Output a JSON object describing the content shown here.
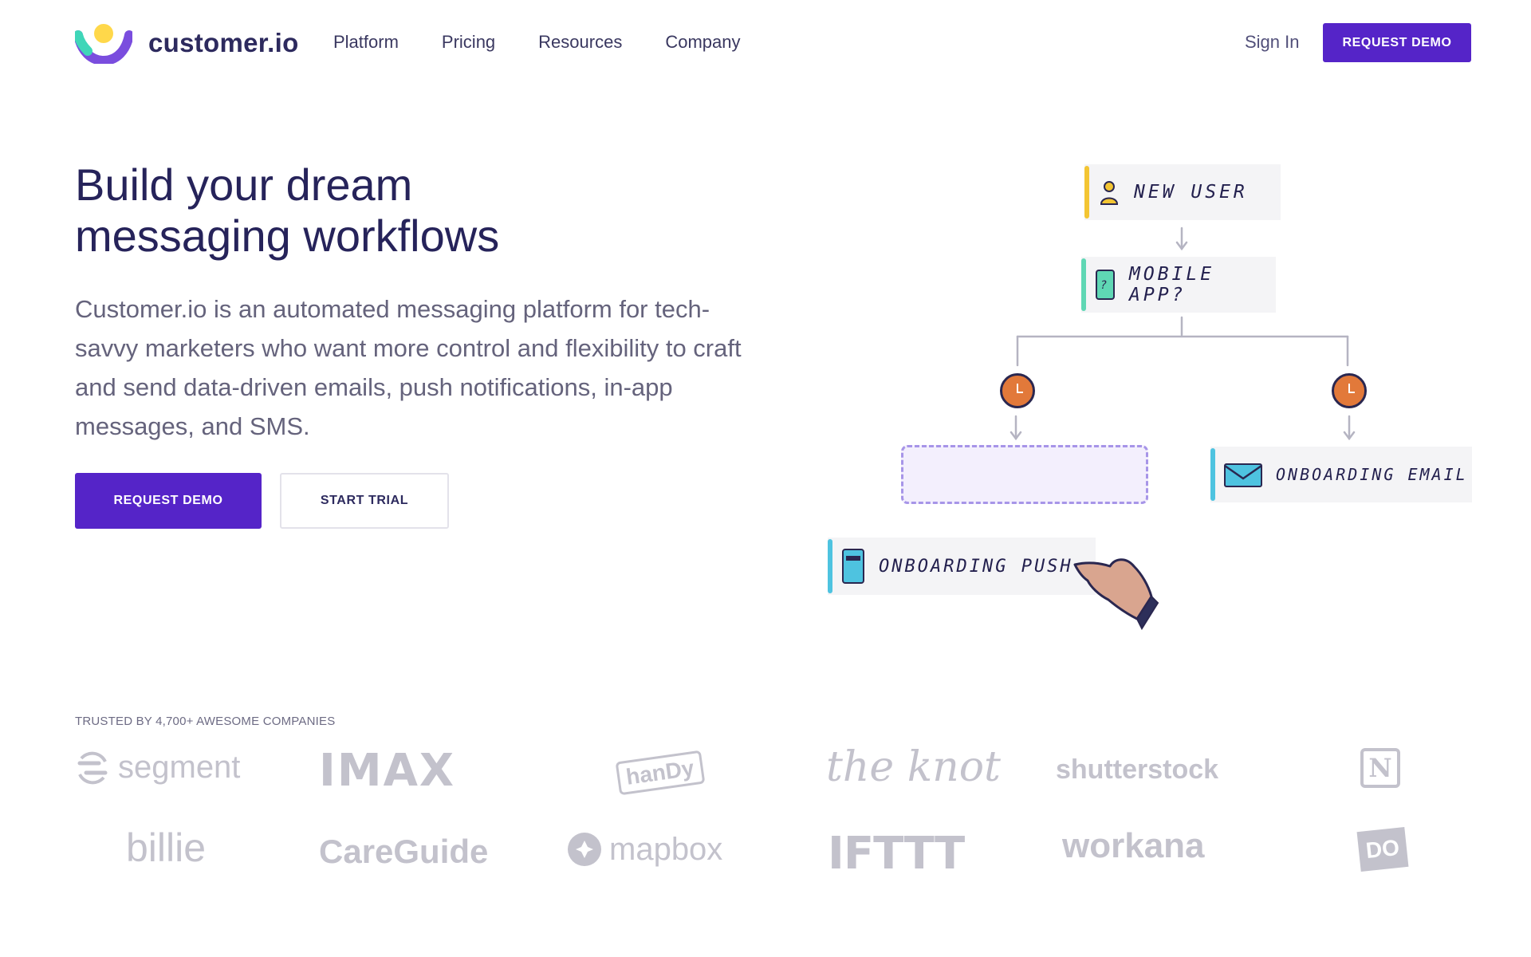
{
  "brand": {
    "name": "customer.io"
  },
  "nav": {
    "items": [
      {
        "label": "Platform"
      },
      {
        "label": "Pricing"
      },
      {
        "label": "Resources"
      },
      {
        "label": "Company"
      }
    ],
    "sign_in": "Sign In",
    "request_demo": "REQUEST DEMO"
  },
  "hero": {
    "title_line1": "Build your dream",
    "title_line2": "messaging workflows",
    "description": "Customer.io is an automated messaging platform for tech-savvy marketers who want more control and flexibility to craft and send data-driven emails, push notifications, in-app messages, and SMS.",
    "primary_cta": "REQUEST DEMO",
    "secondary_cta": "START TRIAL"
  },
  "workflow": {
    "cards": [
      {
        "label": "NEW USER",
        "icon": "person-icon",
        "accent": "#f3c533"
      },
      {
        "label": "MOBILE APP?",
        "icon": "phone-question-icon",
        "accent": "#5fd7b4"
      },
      {
        "label": "ONBOARDING EMAIL",
        "icon": "envelope-icon",
        "accent": "#4ec3e0"
      },
      {
        "label": "ONBOARDING PUSH",
        "icon": "phone-icon",
        "accent": "#4ec3e0"
      }
    ],
    "delay_icon": "clock-icon",
    "cursor_icon": "pointing-hand-icon"
  },
  "trusted": {
    "label": "TRUSTED BY 4,700+ AWESOME COMPANIES",
    "logos": [
      "segment",
      "IMAX",
      "hanDy",
      "the knot",
      "shutterstock",
      "N",
      "billie",
      "CareGuide",
      "mapbox",
      "IFTTT",
      "workana",
      "DO"
    ]
  },
  "colors": {
    "primary": "#5524c8",
    "heading": "#26235a",
    "body_text": "#65637c",
    "logo_gray": "#c3c2cc"
  }
}
